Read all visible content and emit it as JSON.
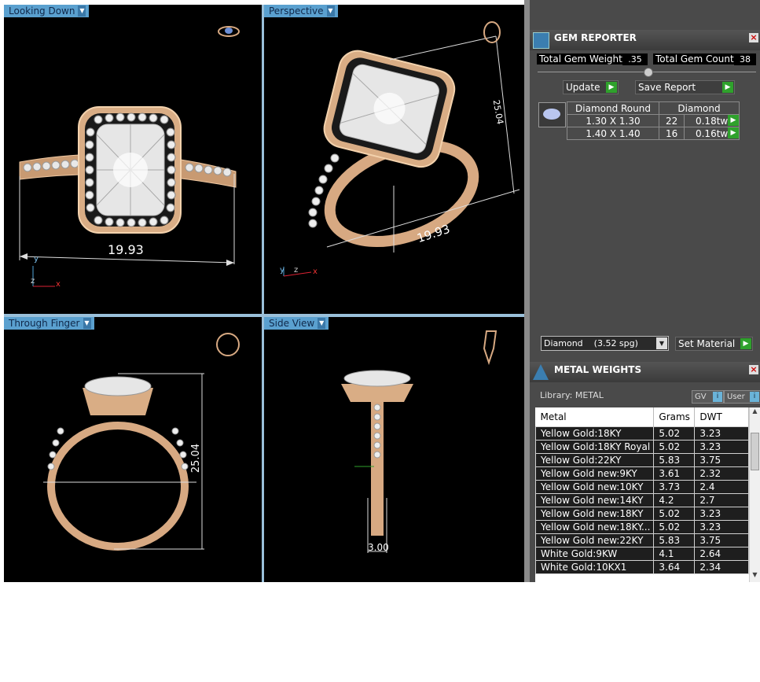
{
  "viewports": {
    "looking_down": {
      "label": "Looking Down",
      "dimension": "19.93"
    },
    "perspective": {
      "label": "Perspective",
      "dimension_width": "19.93",
      "dimension_height": "25.04"
    },
    "through_finger": {
      "label": "Through Finger",
      "dimension": "25.04"
    },
    "side_view": {
      "label": "Side View",
      "dimension": "3.00"
    },
    "axes": {
      "x": "x",
      "y": "y",
      "z": "z"
    }
  },
  "gem_reporter": {
    "title": "GEM REPORTER",
    "total_gem_weight_label": "Total Gem Weight",
    "total_gem_weight_value": ".35",
    "total_gem_count_label": "Total Gem Count",
    "total_gem_count_value": "38",
    "update_label": "Update",
    "save_report_label": "Save Report",
    "table_header": {
      "shape": "Diamond Round",
      "material": "Diamond"
    },
    "rows": [
      {
        "size": "1.30 X 1.30",
        "count": "22",
        "weight": "0.18tw"
      },
      {
        "size": "1.40 X 1.40",
        "count": "16",
        "weight": "0.16tw"
      }
    ],
    "material_select": "Diamond    (3.52 spg)",
    "set_material_label": "Set Material"
  },
  "metal_weights": {
    "title": "METAL WEIGHTS",
    "library_label": "Library: METAL",
    "gv_label": "GV",
    "user_label": "User",
    "columns": [
      "Metal",
      "Grams",
      "DWT"
    ],
    "rows": [
      [
        "Yellow Gold:18KY",
        "5.02",
        "3.23"
      ],
      [
        "Yellow Gold:18KY Royal",
        "5.02",
        "3.23"
      ],
      [
        "Yellow Gold:22KY",
        "5.83",
        "3.75"
      ],
      [
        "Yellow Gold new:9KY",
        "3.61",
        "2.32"
      ],
      [
        "Yellow Gold new:10KY",
        "3.73",
        "2.4"
      ],
      [
        "Yellow Gold new:14KY",
        "4.2",
        "2.7"
      ],
      [
        "Yellow Gold new:18KY",
        "5.02",
        "3.23"
      ],
      [
        "Yellow Gold new:18KY...",
        "5.02",
        "3.23"
      ],
      [
        "Yellow Gold new:22KY",
        "5.83",
        "3.75"
      ],
      [
        "White Gold:9KW",
        "4.1",
        "2.64"
      ],
      [
        "White Gold:10KX1",
        "3.64",
        "2.34"
      ]
    ]
  },
  "colors": {
    "metal": "#d7a982",
    "panel": "#4a4a4a",
    "tab": "#5aa0cf",
    "go": "#2fa12c"
  }
}
